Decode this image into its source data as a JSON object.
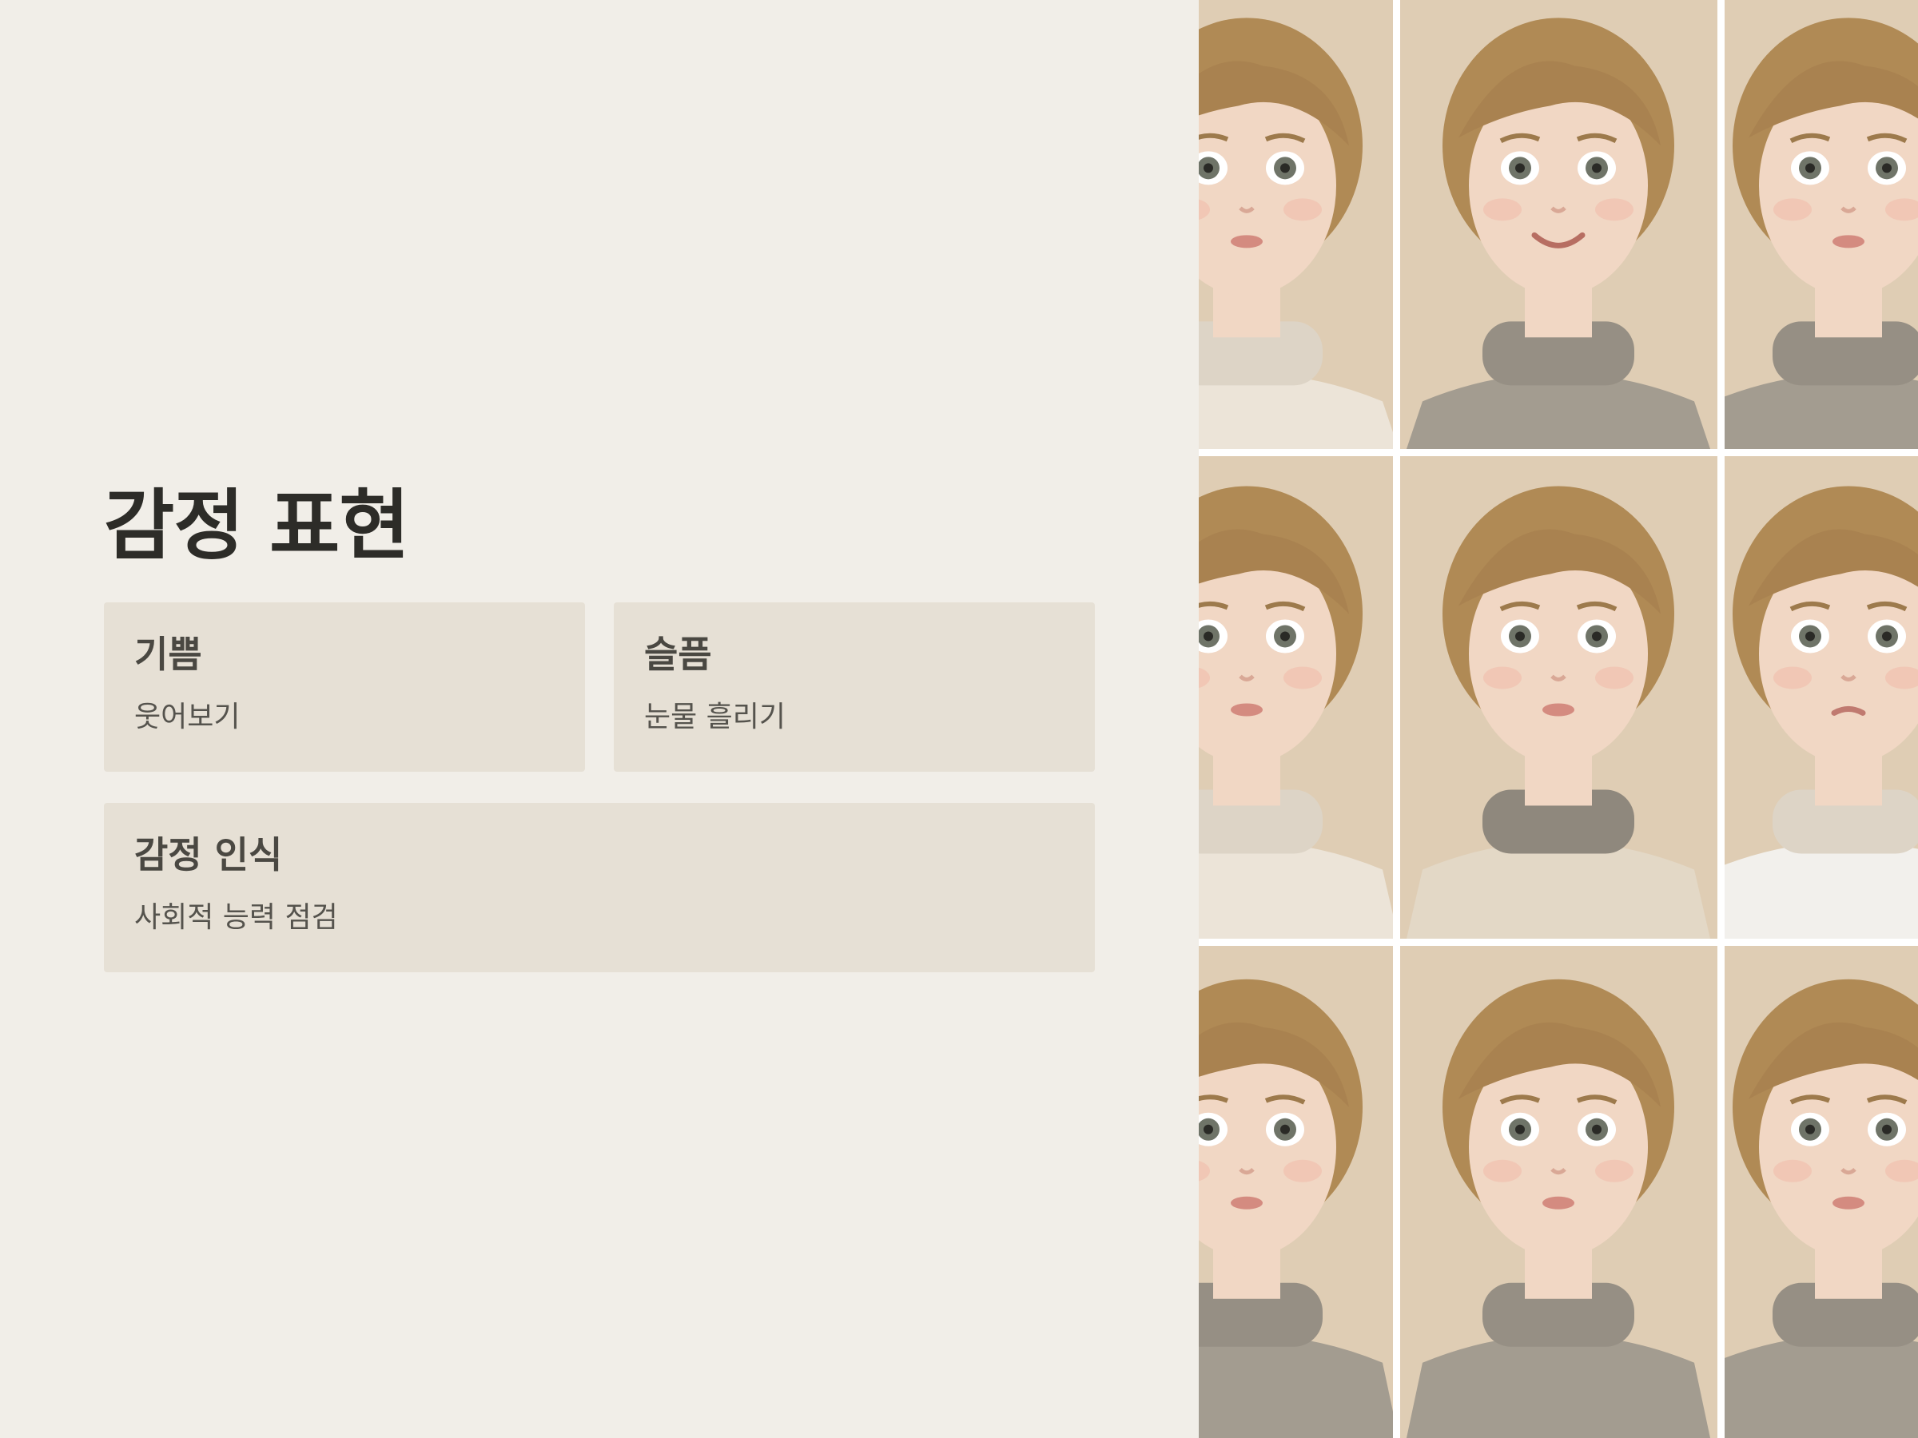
{
  "slide": {
    "title": "감정 표현",
    "cards": [
      {
        "title": "기쁨",
        "subtitle": "웃어보기"
      },
      {
        "title": "슬픔",
        "subtitle": "눈물 흘리기"
      },
      {
        "title": "감정 인식",
        "subtitle": "사회적 능력 점검"
      }
    ]
  },
  "photo_grid": {
    "rows": 3,
    "cols": 3,
    "photos": [
      {
        "subject": "child-portrait",
        "expression": "neutral",
        "sweater": "cream"
      },
      {
        "subject": "child-portrait",
        "expression": "smile",
        "sweater": "grey-turtleneck"
      },
      {
        "subject": "child-portrait",
        "expression": "neutral",
        "sweater": "grey-turtleneck"
      },
      {
        "subject": "child-portrait",
        "expression": "neutral",
        "sweater": "cream"
      },
      {
        "subject": "child-portrait",
        "expression": "neutral",
        "sweater": "beige-grey-collar"
      },
      {
        "subject": "child-portrait",
        "expression": "sad",
        "sweater": "white"
      },
      {
        "subject": "child-portrait",
        "expression": "neutral",
        "sweater": "grey-turtleneck"
      },
      {
        "subject": "child-portrait",
        "expression": "neutral",
        "sweater": "grey-turtleneck"
      },
      {
        "subject": "child-portrait",
        "expression": "neutral",
        "sweater": "grey-turtleneck"
      }
    ]
  },
  "colors": {
    "background": "#f1eee8",
    "card": "#e6e0d5",
    "title_text": "#2d2c28",
    "card_title_text": "#4a4842",
    "card_sub_text": "#55534d",
    "photo_backdrop": "#dfcdb4",
    "hair": "#b08a55",
    "skin": "#f1d7c4",
    "eye": "#6f7468",
    "sweater_grey": "#a39c90",
    "sweater_cream": "#ece4d8",
    "sweater_white": "#f2f0ec"
  }
}
